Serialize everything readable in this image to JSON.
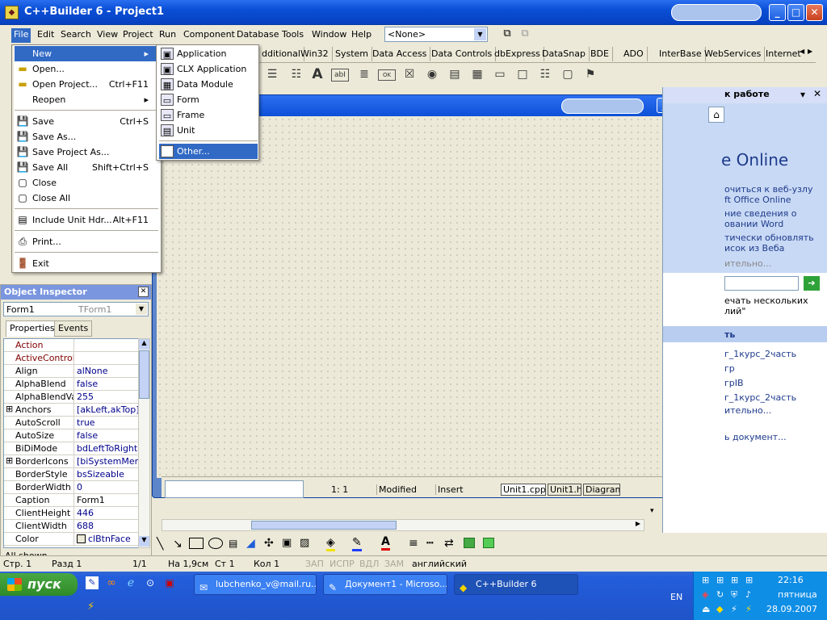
{
  "window": {
    "title": "C++Builder 6 - Project1"
  },
  "menubar": [
    "File",
    "Edit",
    "Search",
    "View",
    "Project",
    "Run",
    "Component",
    "Database",
    "Tools",
    "Window",
    "Help"
  ],
  "toolbar": {
    "combo_value": "<None>"
  },
  "palette_tabs": [
    "dditional",
    "Win32",
    "System",
    "Data Access",
    "Data Controls",
    "dbExpress",
    "DataSnap",
    "BDE",
    "ADO",
    "InterBase",
    "WebServices",
    "Internet"
  ],
  "file_menu": [
    {
      "label": "New",
      "shortcut": "",
      "submenu": true
    },
    {
      "label": "Open...",
      "shortcut": ""
    },
    {
      "label": "Open Project...",
      "shortcut": "Ctrl+F11"
    },
    {
      "label": "Reopen",
      "shortcut": "",
      "submenu": true
    },
    {
      "label": "Save",
      "shortcut": "Ctrl+S"
    },
    {
      "label": "Save As...",
      "shortcut": ""
    },
    {
      "label": "Save Project As...",
      "shortcut": ""
    },
    {
      "label": "Save All",
      "shortcut": "Shift+Ctrl+S"
    },
    {
      "label": "Close",
      "shortcut": ""
    },
    {
      "label": "Close All",
      "shortcut": ""
    },
    {
      "label": "Include Unit Hdr...",
      "shortcut": "Alt+F11"
    },
    {
      "label": "Print...",
      "shortcut": ""
    },
    {
      "label": "Exit",
      "shortcut": ""
    }
  ],
  "new_menu": [
    "Application",
    "CLX Application",
    "Data Module",
    "Form",
    "Frame",
    "Unit",
    "Other..."
  ],
  "object_inspector": {
    "title": "Object Inspector",
    "object": "Form1",
    "type": "TForm1",
    "tabs": [
      "Properties",
      "Events"
    ],
    "rows": [
      {
        "name": "Action",
        "value": "",
        "event": true
      },
      {
        "name": "ActiveControl",
        "value": "",
        "event": true
      },
      {
        "name": "Align",
        "value": "alNone"
      },
      {
        "name": "AlphaBlend",
        "value": "false"
      },
      {
        "name": "AlphaBlendValu",
        "value": "255"
      },
      {
        "name": "Anchors",
        "value": "[akLeft,akTop]",
        "expand": true
      },
      {
        "name": "AutoScroll",
        "value": "true"
      },
      {
        "name": "AutoSize",
        "value": "false"
      },
      {
        "name": "BiDiMode",
        "value": "bdLeftToRight"
      },
      {
        "name": "BorderIcons",
        "value": "[biSystemMenu,",
        "expand": true
      },
      {
        "name": "BorderStyle",
        "value": "bsSizeable"
      },
      {
        "name": "BorderWidth",
        "value": "0"
      },
      {
        "name": "Caption",
        "value": "Form1"
      },
      {
        "name": "ClientHeight",
        "value": "446"
      },
      {
        "name": "ClientWidth",
        "value": "688"
      },
      {
        "name": "Color",
        "value": "clBtnFace"
      }
    ],
    "status": "All shown"
  },
  "editor_status": {
    "position": "1:   1",
    "state": "Modified",
    "mode": "Insert",
    "tabs": [
      "Unit1.cpp",
      "Unit1.h",
      "Diagram"
    ]
  },
  "task_pane": {
    "header": "к работе",
    "brand": "e Online",
    "links1": [
      "очиться к веб-узлу",
      "ft Office Online",
      "ние сведения о",
      "овании Word",
      "тически обновлять",
      "исок из Веба",
      "ительно..."
    ],
    "search_hint": "ечать нескольких лий\"",
    "section": "ть",
    "links2": [
      "г_1курс_2часть",
      "гр",
      "грIB",
      "г_1курс_2часть",
      "ительно...",
      "ь документ..."
    ]
  },
  "word_status": [
    "Стр. 1",
    "Разд 1",
    "1/1",
    "На 1,9см",
    "Ст 1",
    "Кол 1",
    "ЗАП",
    "ИСПР",
    "ВДЛ",
    "ЗАМ",
    "английский"
  ],
  "taskbar": {
    "start": "пуск",
    "tasks": [
      "lubchenko_v@mail.ru....",
      "Документ1 - Microso...",
      "C++Builder 6"
    ],
    "lang": "EN",
    "time": "22:16",
    "day": "пятница",
    "date": "28.09.2007"
  }
}
